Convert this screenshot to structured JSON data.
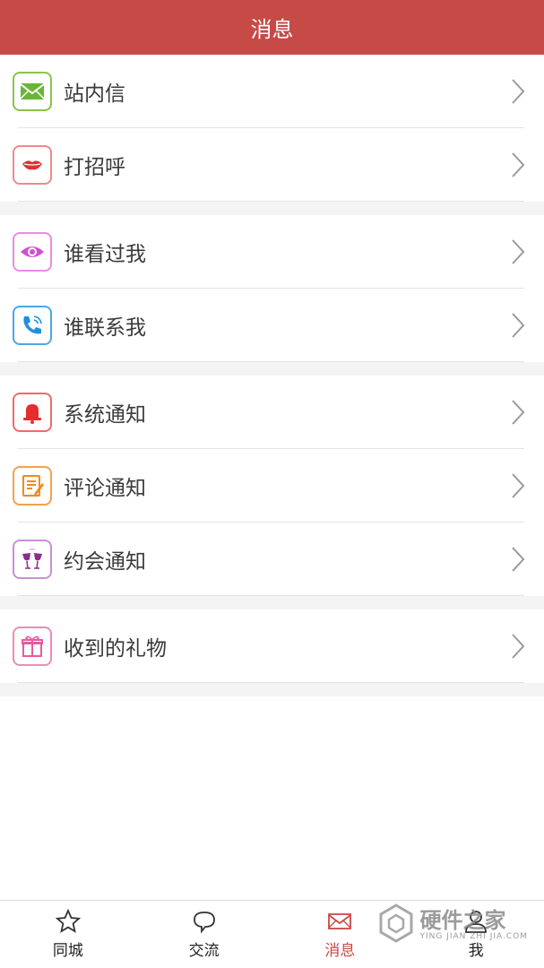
{
  "header": {
    "title": "消息"
  },
  "groups": [
    {
      "items": [
        {
          "label": "站内信",
          "icon": "mail-icon",
          "color": "#8bc34a"
        },
        {
          "label": "打招呼",
          "icon": "lips-icon",
          "color": "#f08a8a"
        }
      ]
    },
    {
      "items": [
        {
          "label": "谁看过我",
          "icon": "eye-icon",
          "color": "#e98de3"
        },
        {
          "label": "谁联系我",
          "icon": "phone-icon",
          "color": "#4aa8e8"
        }
      ]
    },
    {
      "items": [
        {
          "label": "系统通知",
          "icon": "bell-icon",
          "color": "#f06a6a"
        },
        {
          "label": "评论通知",
          "icon": "note-icon",
          "color": "#f5a14a"
        },
        {
          "label": "约会通知",
          "icon": "wine-glasses-icon",
          "color": "#c98fd8"
        }
      ]
    },
    {
      "items": [
        {
          "label": "收到的礼物",
          "icon": "gift-icon",
          "color": "#f08ab8"
        }
      ]
    }
  ],
  "tabs": [
    {
      "label": "同城",
      "icon": "star-icon",
      "active": false
    },
    {
      "label": "交流",
      "icon": "chat-bubble-icon",
      "active": false
    },
    {
      "label": "消息",
      "icon": "envelope-icon",
      "active": true
    },
    {
      "label": "我",
      "icon": "user-icon",
      "active": false
    }
  ],
  "watermark": {
    "main": "硬件之家",
    "sub": "YING JIAN ZHI JIA.COM"
  },
  "colors": {
    "header_bg": "#c64a45",
    "active_tab": "#c64a45",
    "divider": "#e3e3e3",
    "gap": "#f4f4f4"
  }
}
